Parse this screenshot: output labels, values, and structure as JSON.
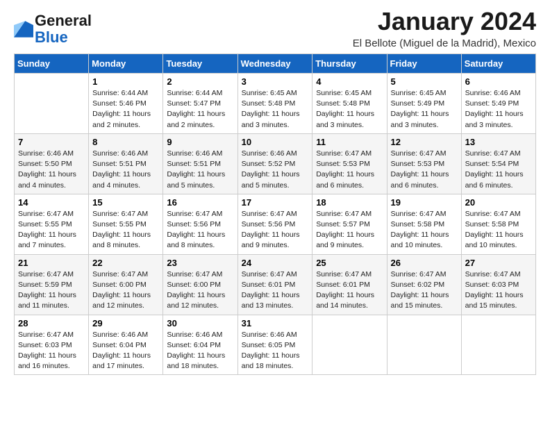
{
  "header": {
    "logo_line1": "General",
    "logo_line2": "Blue",
    "month_title": "January 2024",
    "location": "El Bellote (Miguel de la Madrid), Mexico"
  },
  "weekdays": [
    "Sunday",
    "Monday",
    "Tuesday",
    "Wednesday",
    "Thursday",
    "Friday",
    "Saturday"
  ],
  "weeks": [
    [
      {
        "day": "",
        "info": ""
      },
      {
        "day": "1",
        "info": "Sunrise: 6:44 AM\nSunset: 5:46 PM\nDaylight: 11 hours\nand 2 minutes."
      },
      {
        "day": "2",
        "info": "Sunrise: 6:44 AM\nSunset: 5:47 PM\nDaylight: 11 hours\nand 2 minutes."
      },
      {
        "day": "3",
        "info": "Sunrise: 6:45 AM\nSunset: 5:48 PM\nDaylight: 11 hours\nand 3 minutes."
      },
      {
        "day": "4",
        "info": "Sunrise: 6:45 AM\nSunset: 5:48 PM\nDaylight: 11 hours\nand 3 minutes."
      },
      {
        "day": "5",
        "info": "Sunrise: 6:45 AM\nSunset: 5:49 PM\nDaylight: 11 hours\nand 3 minutes."
      },
      {
        "day": "6",
        "info": "Sunrise: 6:46 AM\nSunset: 5:49 PM\nDaylight: 11 hours\nand 3 minutes."
      }
    ],
    [
      {
        "day": "7",
        "info": "Sunrise: 6:46 AM\nSunset: 5:50 PM\nDaylight: 11 hours\nand 4 minutes."
      },
      {
        "day": "8",
        "info": "Sunrise: 6:46 AM\nSunset: 5:51 PM\nDaylight: 11 hours\nand 4 minutes."
      },
      {
        "day": "9",
        "info": "Sunrise: 6:46 AM\nSunset: 5:51 PM\nDaylight: 11 hours\nand 5 minutes."
      },
      {
        "day": "10",
        "info": "Sunrise: 6:46 AM\nSunset: 5:52 PM\nDaylight: 11 hours\nand 5 minutes."
      },
      {
        "day": "11",
        "info": "Sunrise: 6:47 AM\nSunset: 5:53 PM\nDaylight: 11 hours\nand 6 minutes."
      },
      {
        "day": "12",
        "info": "Sunrise: 6:47 AM\nSunset: 5:53 PM\nDaylight: 11 hours\nand 6 minutes."
      },
      {
        "day": "13",
        "info": "Sunrise: 6:47 AM\nSunset: 5:54 PM\nDaylight: 11 hours\nand 6 minutes."
      }
    ],
    [
      {
        "day": "14",
        "info": "Sunrise: 6:47 AM\nSunset: 5:55 PM\nDaylight: 11 hours\nand 7 minutes."
      },
      {
        "day": "15",
        "info": "Sunrise: 6:47 AM\nSunset: 5:55 PM\nDaylight: 11 hours\nand 8 minutes."
      },
      {
        "day": "16",
        "info": "Sunrise: 6:47 AM\nSunset: 5:56 PM\nDaylight: 11 hours\nand 8 minutes."
      },
      {
        "day": "17",
        "info": "Sunrise: 6:47 AM\nSunset: 5:56 PM\nDaylight: 11 hours\nand 9 minutes."
      },
      {
        "day": "18",
        "info": "Sunrise: 6:47 AM\nSunset: 5:57 PM\nDaylight: 11 hours\nand 9 minutes."
      },
      {
        "day": "19",
        "info": "Sunrise: 6:47 AM\nSunset: 5:58 PM\nDaylight: 11 hours\nand 10 minutes."
      },
      {
        "day": "20",
        "info": "Sunrise: 6:47 AM\nSunset: 5:58 PM\nDaylight: 11 hours\nand 10 minutes."
      }
    ],
    [
      {
        "day": "21",
        "info": "Sunrise: 6:47 AM\nSunset: 5:59 PM\nDaylight: 11 hours\nand 11 minutes."
      },
      {
        "day": "22",
        "info": "Sunrise: 6:47 AM\nSunset: 6:00 PM\nDaylight: 11 hours\nand 12 minutes."
      },
      {
        "day": "23",
        "info": "Sunrise: 6:47 AM\nSunset: 6:00 PM\nDaylight: 11 hours\nand 12 minutes."
      },
      {
        "day": "24",
        "info": "Sunrise: 6:47 AM\nSunset: 6:01 PM\nDaylight: 11 hours\nand 13 minutes."
      },
      {
        "day": "25",
        "info": "Sunrise: 6:47 AM\nSunset: 6:01 PM\nDaylight: 11 hours\nand 14 minutes."
      },
      {
        "day": "26",
        "info": "Sunrise: 6:47 AM\nSunset: 6:02 PM\nDaylight: 11 hours\nand 15 minutes."
      },
      {
        "day": "27",
        "info": "Sunrise: 6:47 AM\nSunset: 6:03 PM\nDaylight: 11 hours\nand 15 minutes."
      }
    ],
    [
      {
        "day": "28",
        "info": "Sunrise: 6:47 AM\nSunset: 6:03 PM\nDaylight: 11 hours\nand 16 minutes."
      },
      {
        "day": "29",
        "info": "Sunrise: 6:46 AM\nSunset: 6:04 PM\nDaylight: 11 hours\nand 17 minutes."
      },
      {
        "day": "30",
        "info": "Sunrise: 6:46 AM\nSunset: 6:04 PM\nDaylight: 11 hours\nand 18 minutes."
      },
      {
        "day": "31",
        "info": "Sunrise: 6:46 AM\nSunset: 6:05 PM\nDaylight: 11 hours\nand 18 minutes."
      },
      {
        "day": "",
        "info": ""
      },
      {
        "day": "",
        "info": ""
      },
      {
        "day": "",
        "info": ""
      }
    ]
  ]
}
